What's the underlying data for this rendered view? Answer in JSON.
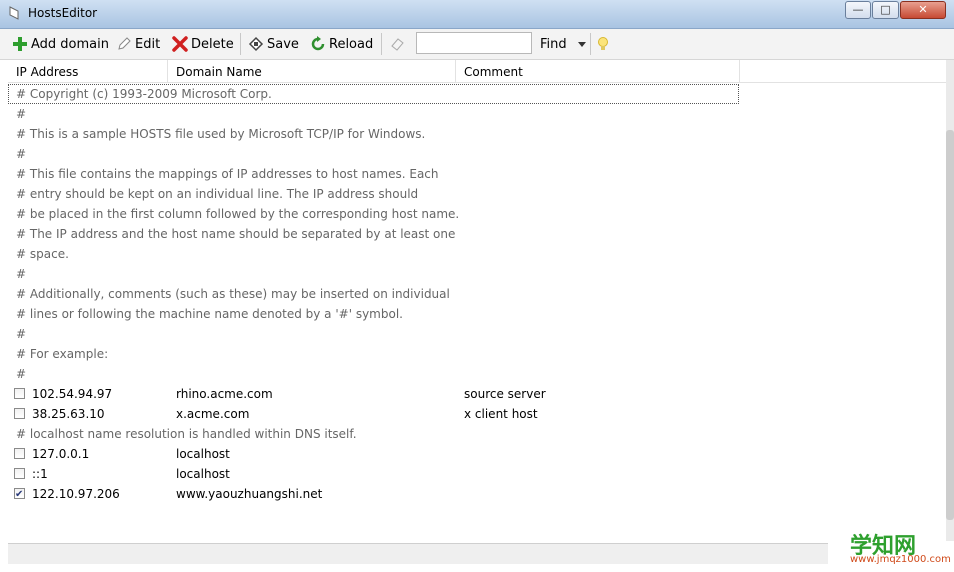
{
  "window": {
    "title": "HostsEditor"
  },
  "toolbar": {
    "add_label": "Add domain",
    "edit_label": "Edit",
    "delete_label": "Delete",
    "save_label": "Save",
    "reload_label": "Reload",
    "search_value": "",
    "find_label": "Find"
  },
  "columns": {
    "ip": "IP Address",
    "domain": "Domain Name",
    "comment": "Comment"
  },
  "rows": [
    {
      "type": "comment",
      "text": "# Copyright (c) 1993-2009 Microsoft Corp."
    },
    {
      "type": "comment",
      "text": "#"
    },
    {
      "type": "comment",
      "text": "# This is a sample HOSTS file used by Microsoft TCP/IP for Windows."
    },
    {
      "type": "comment",
      "text": "#"
    },
    {
      "type": "comment",
      "text": "# This file contains the mappings of IP addresses to host names. Each"
    },
    {
      "type": "comment",
      "text": "# entry should be kept on an individual line. The IP address should"
    },
    {
      "type": "comment",
      "text": "# be placed in the first column followed by the corresponding host name."
    },
    {
      "type": "comment",
      "text": "# The IP address and the host name should be separated by at least one"
    },
    {
      "type": "comment",
      "text": "# space."
    },
    {
      "type": "comment",
      "text": "#"
    },
    {
      "type": "comment",
      "text": "# Additionally, comments (such as these) may be inserted on individual"
    },
    {
      "type": "comment",
      "text": "# lines or following the machine name denoted by a '#' symbol."
    },
    {
      "type": "comment",
      "text": "#"
    },
    {
      "type": "comment",
      "text": "# For example:"
    },
    {
      "type": "comment",
      "text": "#"
    },
    {
      "type": "entry",
      "checked": false,
      "ip": "102.54.94.97",
      "domain": "rhino.acme.com",
      "comment": "source server"
    },
    {
      "type": "entry",
      "checked": false,
      "ip": "38.25.63.10",
      "domain": "x.acme.com",
      "comment": "x client host"
    },
    {
      "type": "comment",
      "text": "# localhost name resolution is handled within DNS itself."
    },
    {
      "type": "entry",
      "checked": false,
      "ip": "127.0.0.1",
      "domain": "localhost",
      "comment": ""
    },
    {
      "type": "entry",
      "checked": false,
      "ip": "::1",
      "domain": "localhost",
      "comment": ""
    },
    {
      "type": "entry",
      "checked": true,
      "ip": "122.10.97.206",
      "domain": "www.yaouzhuangshi.net",
      "comment": ""
    }
  ],
  "watermark": {
    "main": "学知网",
    "sub": "www.jmqz1000.com"
  },
  "colors": {
    "add": "#2e9e2e",
    "delete": "#d02020",
    "reload": "#2f8f2f",
    "title_bar": "#bcd3ec"
  }
}
